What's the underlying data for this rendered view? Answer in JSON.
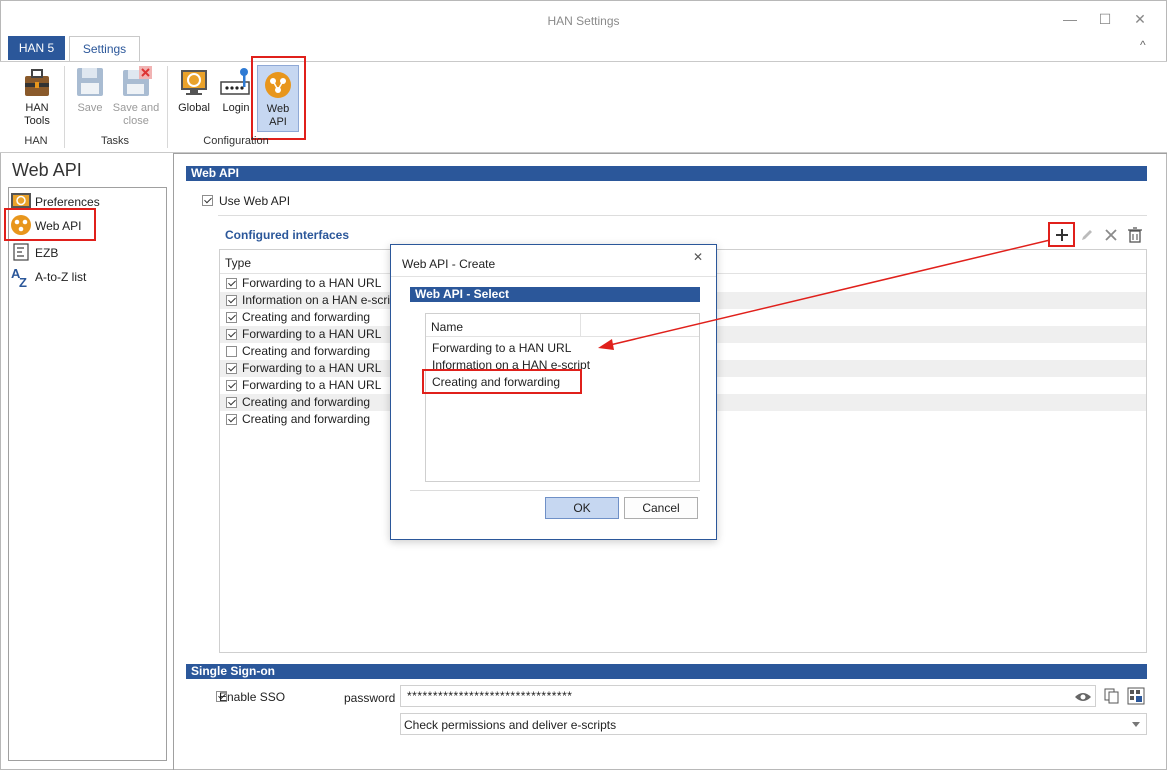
{
  "window": {
    "title": "HAN Settings",
    "min_glyph": "—",
    "max_glyph": "☐",
    "close_glyph": "✕",
    "collapse_glyph": "^"
  },
  "tabs": {
    "han5": "HAN 5",
    "settings": "Settings"
  },
  "ribbon": {
    "han_tools_line1": "HAN",
    "han_tools_line2": "Tools",
    "save": "Save",
    "save_close_line1": "Save and",
    "save_close_line2": "close",
    "global": "Global",
    "login": "Login",
    "webapi_line1": "Web",
    "webapi_line2": "API",
    "group_han": "HAN",
    "group_tasks": "Tasks",
    "group_config": "Configuration"
  },
  "sidebar": {
    "title": "Web API",
    "items": [
      {
        "label": "Preferences",
        "icon": "preferences-icon"
      },
      {
        "label": "Web API",
        "icon": "web-api-icon"
      },
      {
        "label": "EZB",
        "icon": "ezb-icon"
      },
      {
        "label": "A-to-Z list",
        "icon": "a-to-z-icon"
      }
    ]
  },
  "webapi_section": {
    "header": "Web API",
    "use_label": "Use Web API",
    "use_checked": true,
    "configured_title": "Configured interfaces",
    "column_type": "Type",
    "rows": [
      {
        "label": "Forwarding to a HAN URL",
        "checked": true
      },
      {
        "label": "Information on a HAN e-script",
        "checked": true
      },
      {
        "label": "Creating and forwarding",
        "checked": true
      },
      {
        "label": "Forwarding to a HAN URL",
        "checked": true
      },
      {
        "label": "Creating and forwarding",
        "checked": false
      },
      {
        "label": "Forwarding to a HAN URL",
        "checked": true
      },
      {
        "label": "Forwarding to a HAN URL",
        "checked": true
      },
      {
        "label": "Creating and forwarding",
        "checked": true
      },
      {
        "label": "Creating and forwarding",
        "checked": true
      }
    ]
  },
  "dialog": {
    "title": "Web API - Create",
    "close_glyph": "✕",
    "section": "Web API - Select",
    "column_name": "Name",
    "items": [
      "Forwarding to a HAN URL",
      "Information on a HAN e-script",
      "Creating and forwarding"
    ],
    "ok": "OK",
    "cancel": "Cancel"
  },
  "sso": {
    "header": "Single Sign-on",
    "enable_label": "Enable SSO",
    "enable_checked": true,
    "password_label": "password",
    "password_value": "********************************",
    "mode_value": "Check permissions and deliver e-scripts"
  },
  "colors": {
    "accent": "#2b579a",
    "highlight": "#e0201b",
    "orange": "#e8961c"
  }
}
